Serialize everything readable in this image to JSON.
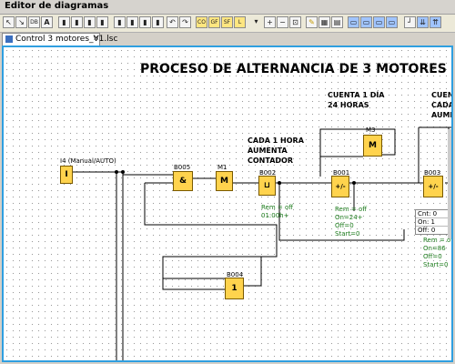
{
  "window": {
    "title": "Editor de diagramas"
  },
  "toolbar": {
    "buttons": [
      "pointer-icon",
      "connector-icon",
      "db-icon",
      "text-icon",
      "and-gate-icon",
      "nand-gate-icon",
      "or-gate-icon",
      "nor-gate-icon",
      "undo-icon",
      "redo-icon",
      "co-icon",
      "gf-icon",
      "sf-icon",
      "l-icon",
      "zoom-in-icon",
      "zoom-out-icon",
      "fit-icon",
      "pen-icon",
      "shapes-icon",
      "table-icon",
      "align-left-icon",
      "align-center-icon",
      "align-right-icon",
      "arrange-icon",
      "align-bottom-icon",
      "align-top-icon"
    ]
  },
  "tab": {
    "label": "Control 3 motores_V1.lsc"
  },
  "diagram": {
    "title": "PROCESO DE ALTERNANCIA DE 3 MOTORES",
    "notes": {
      "cuenta1": "CUENTA 1 DÍA",
      "cuenta2": "24 HORAS",
      "cada1": "CADA 1 HORA",
      "aumenta": "AUMENTA",
      "contador": "CONTADOR",
      "right1": "CUENT",
      "right2": "CADA",
      "right3": "AUMEN"
    },
    "input": {
      "label": "I4 (Manual/AUTO)",
      "symbol": "I"
    },
    "blocks": {
      "b005": {
        "label": "B005",
        "symbol": "&"
      },
      "m1": {
        "label": "M1",
        "symbol": "M"
      },
      "b002": {
        "label": "B002",
        "symbol": "⊔",
        "params": [
          "Rem = off",
          "01:00h+"
        ]
      },
      "m3": {
        "label": "M3",
        "symbol": "M"
      },
      "b001": {
        "label": "B001",
        "symbol": "+/-",
        "params": [
          "Rem = off",
          "On=24+",
          "Off=0",
          "Start=0"
        ]
      },
      "b003": {
        "label": "B003",
        "symbol": "+/-"
      },
      "b004": {
        "label": "B004",
        "symbol": "1"
      }
    },
    "right_panel": {
      "rows": [
        "Cnt: 0",
        "On: 1",
        "Off: 0"
      ],
      "params": [
        "Rem = off",
        "On=86",
        "Off=0",
        "Start=0"
      ]
    }
  }
}
